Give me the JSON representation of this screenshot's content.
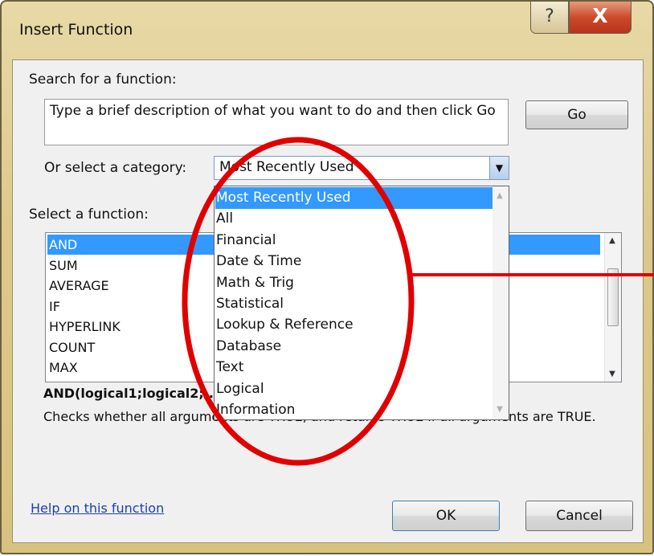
{
  "window": {
    "title": "Insert Function",
    "help_glyph": "?",
    "close_glyph": "X"
  },
  "search": {
    "label": "Search for a function:",
    "value": "Type a brief description of what you want to do and then click Go",
    "go_label": "Go"
  },
  "category": {
    "label": "Or select a category:",
    "selected": "Most Recently Used",
    "options": [
      "Most Recently Used",
      "All",
      "Financial",
      "Date & Time",
      "Math & Trig",
      "Statistical",
      "Lookup & Reference",
      "Database",
      "Text",
      "Logical",
      "Information"
    ]
  },
  "functions": {
    "label": "Select a function:",
    "items": [
      "AND",
      "SUM",
      "AVERAGE",
      "IF",
      "HYPERLINK",
      "COUNT",
      "MAX"
    ],
    "selected": "AND"
  },
  "details": {
    "signature": "AND(logical1;logical2;...)",
    "description": "Checks whether all arguments are TRUE, and returns TRUE if all arguments are TRUE."
  },
  "footer": {
    "help_link": "Help on this function",
    "ok_label": "OK",
    "cancel_label": "Cancel"
  },
  "colors": {
    "selection": "#3399ff",
    "annotation": "#e00000",
    "frame": "#d8c27f"
  },
  "icons": [
    "help-icon",
    "close-icon",
    "dropdown-arrow-icon",
    "scroll-up-icon",
    "scroll-down-icon"
  ]
}
